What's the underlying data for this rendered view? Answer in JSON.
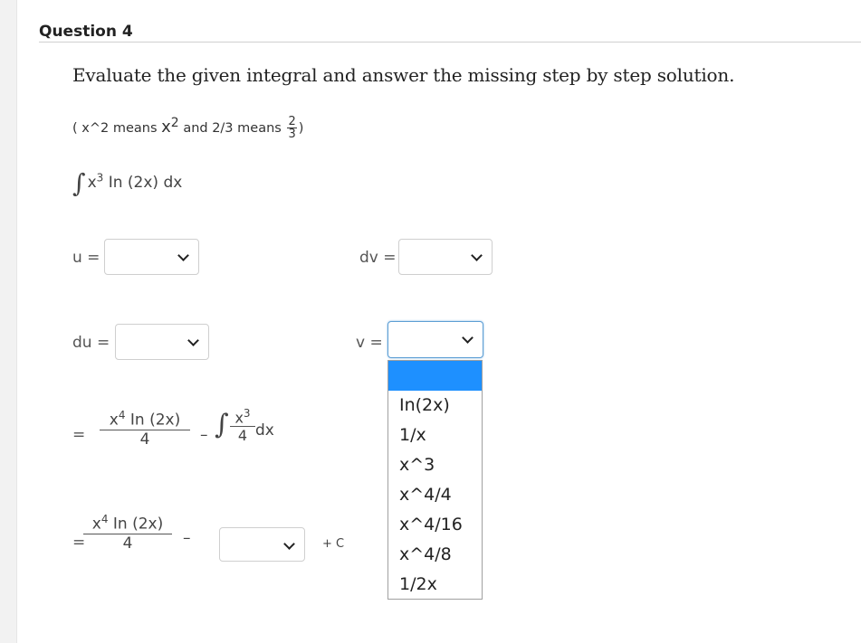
{
  "question": {
    "title": "Question 4"
  },
  "instruction": "Evaluate the given integral and answer the missing step by step solution.",
  "hint": {
    "open": "( x^2 means",
    "base": "x",
    "exp": "2",
    "mid": "and 2/3 means",
    "num": "2",
    "den": "3",
    "close": ")"
  },
  "integral": {
    "symbol": "∫",
    "base": "x",
    "exp": "3",
    "rest": "In (2x) dx"
  },
  "labels": {
    "u": "u =",
    "dv": "dv =",
    "du": "du =",
    "v": "v ="
  },
  "step1": {
    "eq": "=",
    "frac_num_base": "x",
    "frac_num_exp": "4",
    "frac_num_rest": "In (2x)",
    "frac_den": "4",
    "minus": "–",
    "int_symbol": "∫",
    "int_num_base": "x",
    "int_num_exp": "3",
    "int_den": "4",
    "dx": "dx"
  },
  "step2": {
    "eq": "=",
    "frac_num_base": "x",
    "frac_num_exp": "4",
    "frac_num_rest": "In (2x)",
    "frac_den": "4",
    "minus": "–",
    "plus_c": "+ C"
  },
  "dropdown_options": [
    "",
    "In(2x)",
    "1/x",
    "x^3",
    "x^4/4",
    "x^4/16",
    "x^4/8",
    "1/2x"
  ]
}
